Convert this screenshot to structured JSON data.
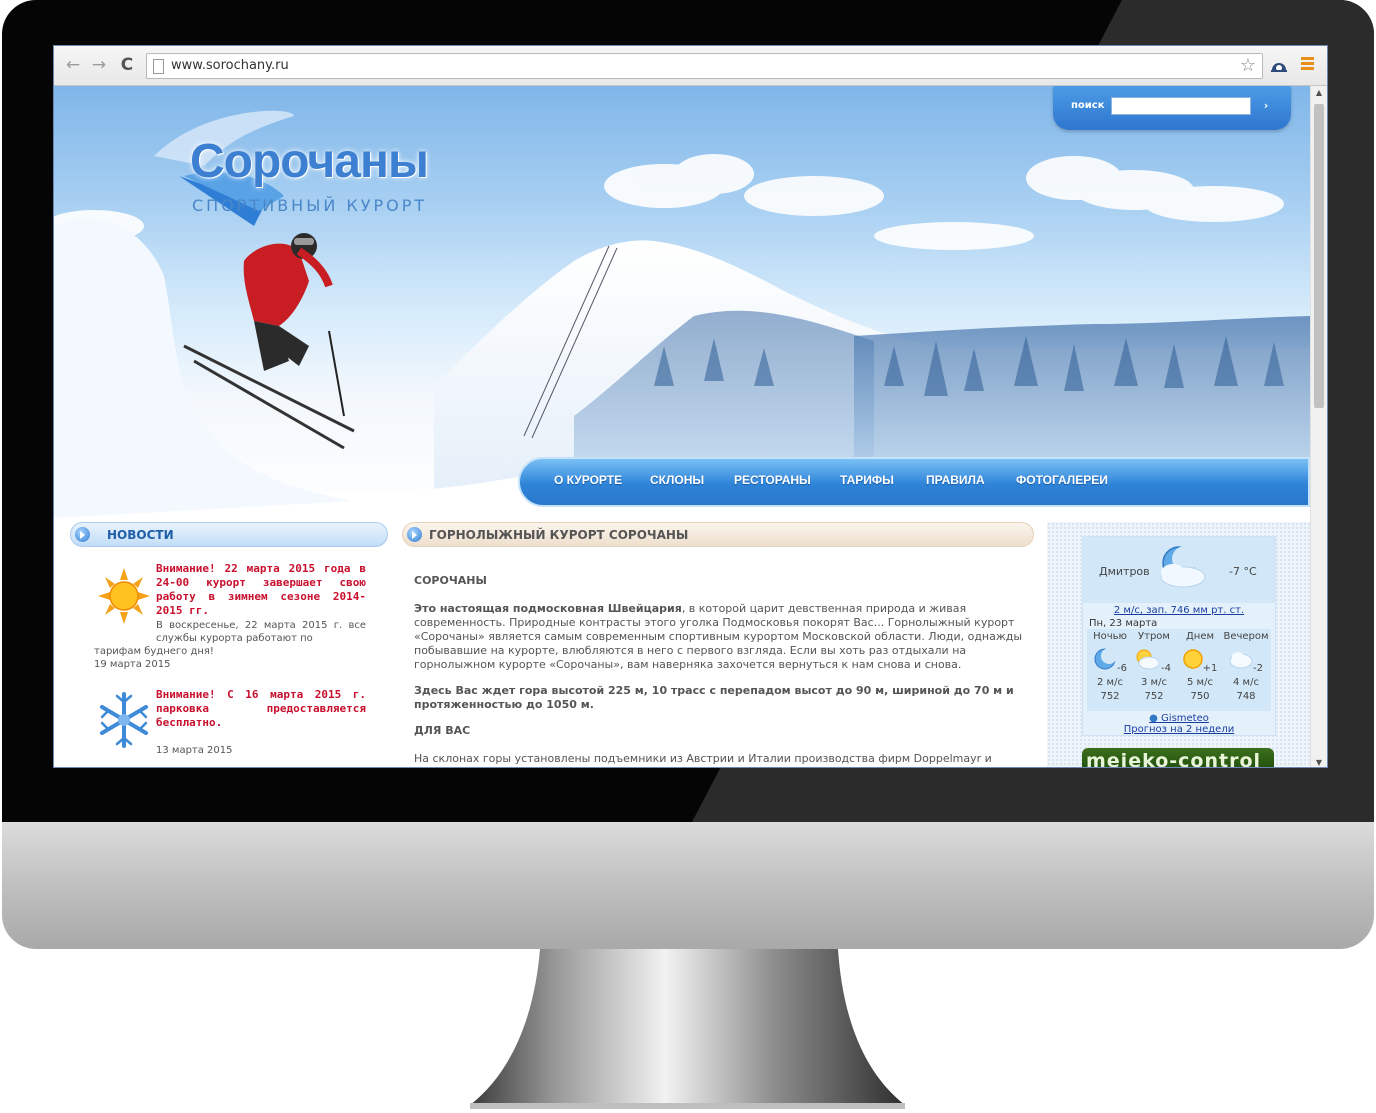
{
  "browser": {
    "url": "www.sorochany.ru",
    "back_glyph": "←",
    "forward_glyph": "→",
    "reload_glyph": "C",
    "star_glyph": "☆",
    "icons": [
      "back-arrow-icon",
      "forward-arrow-icon",
      "reload-icon",
      "page-icon",
      "bookmark-star-icon",
      "extension-icon",
      "menu-icon"
    ]
  },
  "site": {
    "logo_title": "Сорочаны",
    "logo_subtitle": "СПОРТИВНЫЙ КУРОРТ",
    "search": {
      "label": "поиск",
      "value": "",
      "button_glyph": "›"
    },
    "nav": [
      "О КУРОРТЕ",
      "СКЛОНЫ",
      "РЕСТОРАНЫ",
      "ТАРИФЫ",
      "ПРАВИЛА",
      "ФОТОГАЛЕРЕИ"
    ]
  },
  "news": {
    "title": "НОВОСТИ",
    "items": [
      {
        "icon": "sun-icon",
        "title": "Внимание! 22 марта 2015 года в 24-00 курорт завершает свою работу в зимнем сезоне 2014-2015 гг.",
        "text_a": "В воскресенье, 22 марта 2015 г. все службы курорта работают по",
        "text_b": "тарифам буднего дня!",
        "date": "19 марта 2015"
      },
      {
        "icon": "snowflake-icon",
        "title": "Внимание! С 16 марта 2015 г. парковка предоставляется бесплатно.",
        "date": "13 марта 2015"
      }
    ]
  },
  "main": {
    "title": "ГОРНОЛЫЖНЫЙ КУРОРТ СОРОЧАНЫ",
    "heading": "СОРОЧАНЫ",
    "p1_bold": "Это настоящая подмосковная Швейцария",
    "p1_rest": ", в которой царит девственная природа и живая современность. Природные контрасты этого уголка Подмосковья покорят Вас... Горнолыжный курорт «Сорочаны» является самым современным спортивным курортом Московской области. Люди, однажды побывавшие на курорте, влюбляются в него с первого взгляда. Если вы хоть раз отдыхали на горнолыжном курорте «Сорочаны», вам наверняка захочется вернуться к нам снова и снова.",
    "p2": "Здесь Вас ждет гора высотой 225 м, 10 трасс с перепадом высот до 90 м, шириной до 70 м и протяженностью до 1050 м.",
    "heading2": "ДЛЯ ВАС",
    "p3": "На склонах горы установлены подъемники из Австрии и Италии производства фирм Doppelmayr и Leitner:"
  },
  "weather": {
    "city": "Дмитров",
    "temp": "-7 °C",
    "wind_line": "2 м/с, зап. 746 мм рт. ст.",
    "date": "Пн, 23 марта",
    "periods": [
      {
        "label": "Ночью",
        "icon": "moon-icon",
        "temp": "-6",
        "wind": "2 м/с",
        "pressure": "752"
      },
      {
        "label": "Утром",
        "icon": "sun-cloud-icon",
        "temp": "-4",
        "wind": "3 м/с",
        "pressure": "752"
      },
      {
        "label": "Днем",
        "icon": "sun-icon",
        "temp": "+1",
        "wind": "5 м/с",
        "pressure": "750"
      },
      {
        "label": "Вечером",
        "icon": "cloud-icon",
        "temp": "-2",
        "wind": "4 м/с",
        "pressure": "748"
      }
    ],
    "source": "Gismeteo",
    "forecast_link": "Прогноз на 2 недели",
    "banner_text": "mejeko-control"
  },
  "colors": {
    "accent_blue": "#2f84d8",
    "news_red": "#c8102e",
    "link_blue": "#1a3ea0"
  }
}
